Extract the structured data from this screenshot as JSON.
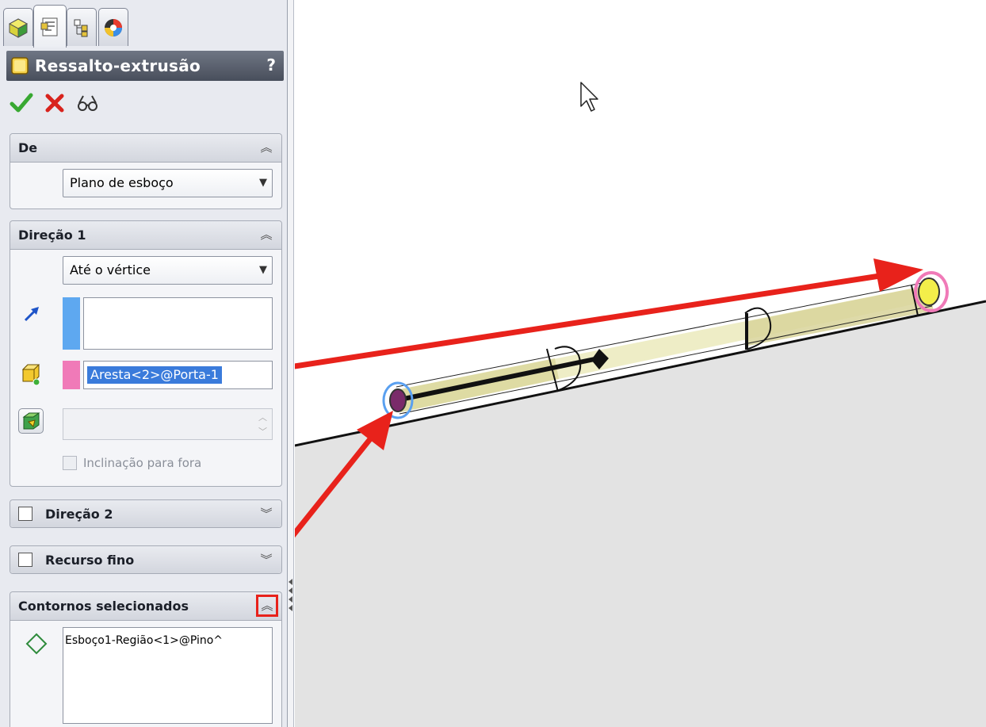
{
  "property_manager": {
    "title": "Ressalto-extrusão",
    "help_label": "?",
    "groups": {
      "from": {
        "title": "De",
        "start_condition": "Plano de esboço"
      },
      "direction1": {
        "title": "Direção 1",
        "end_condition": "Até o vértice",
        "vertex_selection": "Aresta<2>@Porta-1",
        "draft_outward_label": "Inclinação para fora"
      },
      "direction2": {
        "title": "Direção 2"
      },
      "thin_feature": {
        "title": "Recurso fino"
      },
      "selected_contours": {
        "title": "Contornos selecionados",
        "items": [
          "Esboço1-Região<1>@Pino^"
        ]
      }
    }
  },
  "colors": {
    "annotation_red": "#e8221b",
    "selection_pink": "#f07ab8",
    "selection_blue": "#5aa0f0",
    "part_yellow": "#ecebc0",
    "floor_gray": "#e3e3e3"
  },
  "icons": [
    "feature-manager-icon",
    "property-manager-icon",
    "configuration-manager-icon",
    "appearance-icon",
    "extrude-boss-icon",
    "ok-checkmark-icon",
    "cancel-x-icon",
    "detailed-preview-icon",
    "reverse-direction-arrow-icon",
    "vertex-cube-icon",
    "draft-icon",
    "contour-region-icon",
    "mouse-pointer-icon"
  ]
}
